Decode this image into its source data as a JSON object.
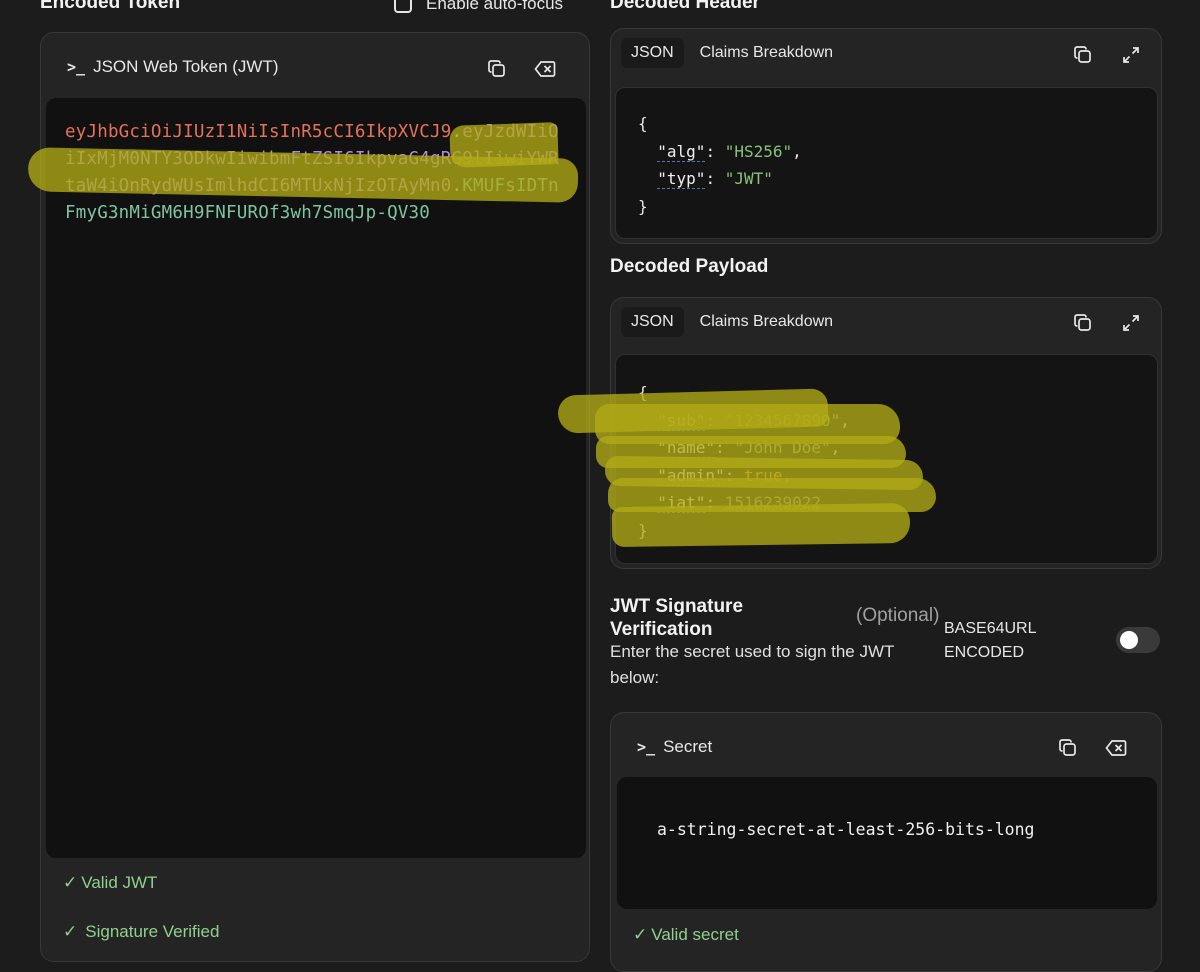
{
  "encoded": {
    "heading": "Encoded Token",
    "autofocus_label": "Enable auto-focus",
    "panel_title": "JSON Web Token (JWT)",
    "token_header": "eyJhbGciOiJIUzI1NiIsInR5cCI6IkpXVCJ9",
    "token_payload": "eyJzdWIiOiIxMjM0NTY3ODkwIiwibmFtZSI6IkpvaG4gRG9lIiwiYWRtaW4iOnRydWUsImlhdCI6MTUxNjIzOTAyMn0",
    "token_signature": "KMUFsIDTnFmyG3nMiGM6H9FNFUROf3wh7SmqJp-QV30",
    "dot": ".",
    "status_valid": "Valid JWT",
    "status_verified": "Signature Verified",
    "check_glyph": "✓"
  },
  "decoded_header": {
    "heading": "Decoded Header",
    "tab_json": "JSON",
    "tab_claims": "Claims Breakdown",
    "alg_key": "\"alg\"",
    "alg_value": "\"HS256\"",
    "typ_key": "\"typ\"",
    "typ_value": "\"JWT\""
  },
  "decoded_payload": {
    "heading": "Decoded Payload",
    "tab_json": "JSON",
    "tab_claims": "Claims Breakdown",
    "sub_key": "\"sub\"",
    "sub_value": "\"1234567890\"",
    "name_key": "\"name\"",
    "name_value": "\"John Doe\"",
    "admin_key": "\"admin\"",
    "admin_value": "true",
    "iat_key": "\"iat\"",
    "iat_value": "1516239022"
  },
  "signature": {
    "heading_line1": "JWT Signature",
    "heading_line2": "Verification",
    "optional": "(Optional)",
    "description_line1": "Enter the secret used to sign the JWT",
    "description_line2": "below:",
    "encoding_line1": "BASE64URL",
    "encoding_line2": "ENCODED",
    "secret_title": "Secret",
    "secret_value": "a-string-secret-at-least-256-bits-long",
    "secret_status": "Valid secret"
  },
  "punct": {
    "open": "{",
    "close": "}",
    "colon": ": ",
    "comma": ","
  },
  "icons": {
    "prompt": "prompt-icon",
    "copy": "copy-icon",
    "clear": "clear-icon",
    "expand": "expand-icon",
    "check": "check-icon"
  },
  "colors": {
    "background": "#1c1c1c",
    "token_header": "#e2735a",
    "token_payload": "#b08ee8",
    "token_signature": "#7fc4a0",
    "json_string": "#86c37a",
    "json_boolean": "#e6a33d",
    "status_ok": "#8fd08c",
    "highlighter": "#b2aa16"
  }
}
